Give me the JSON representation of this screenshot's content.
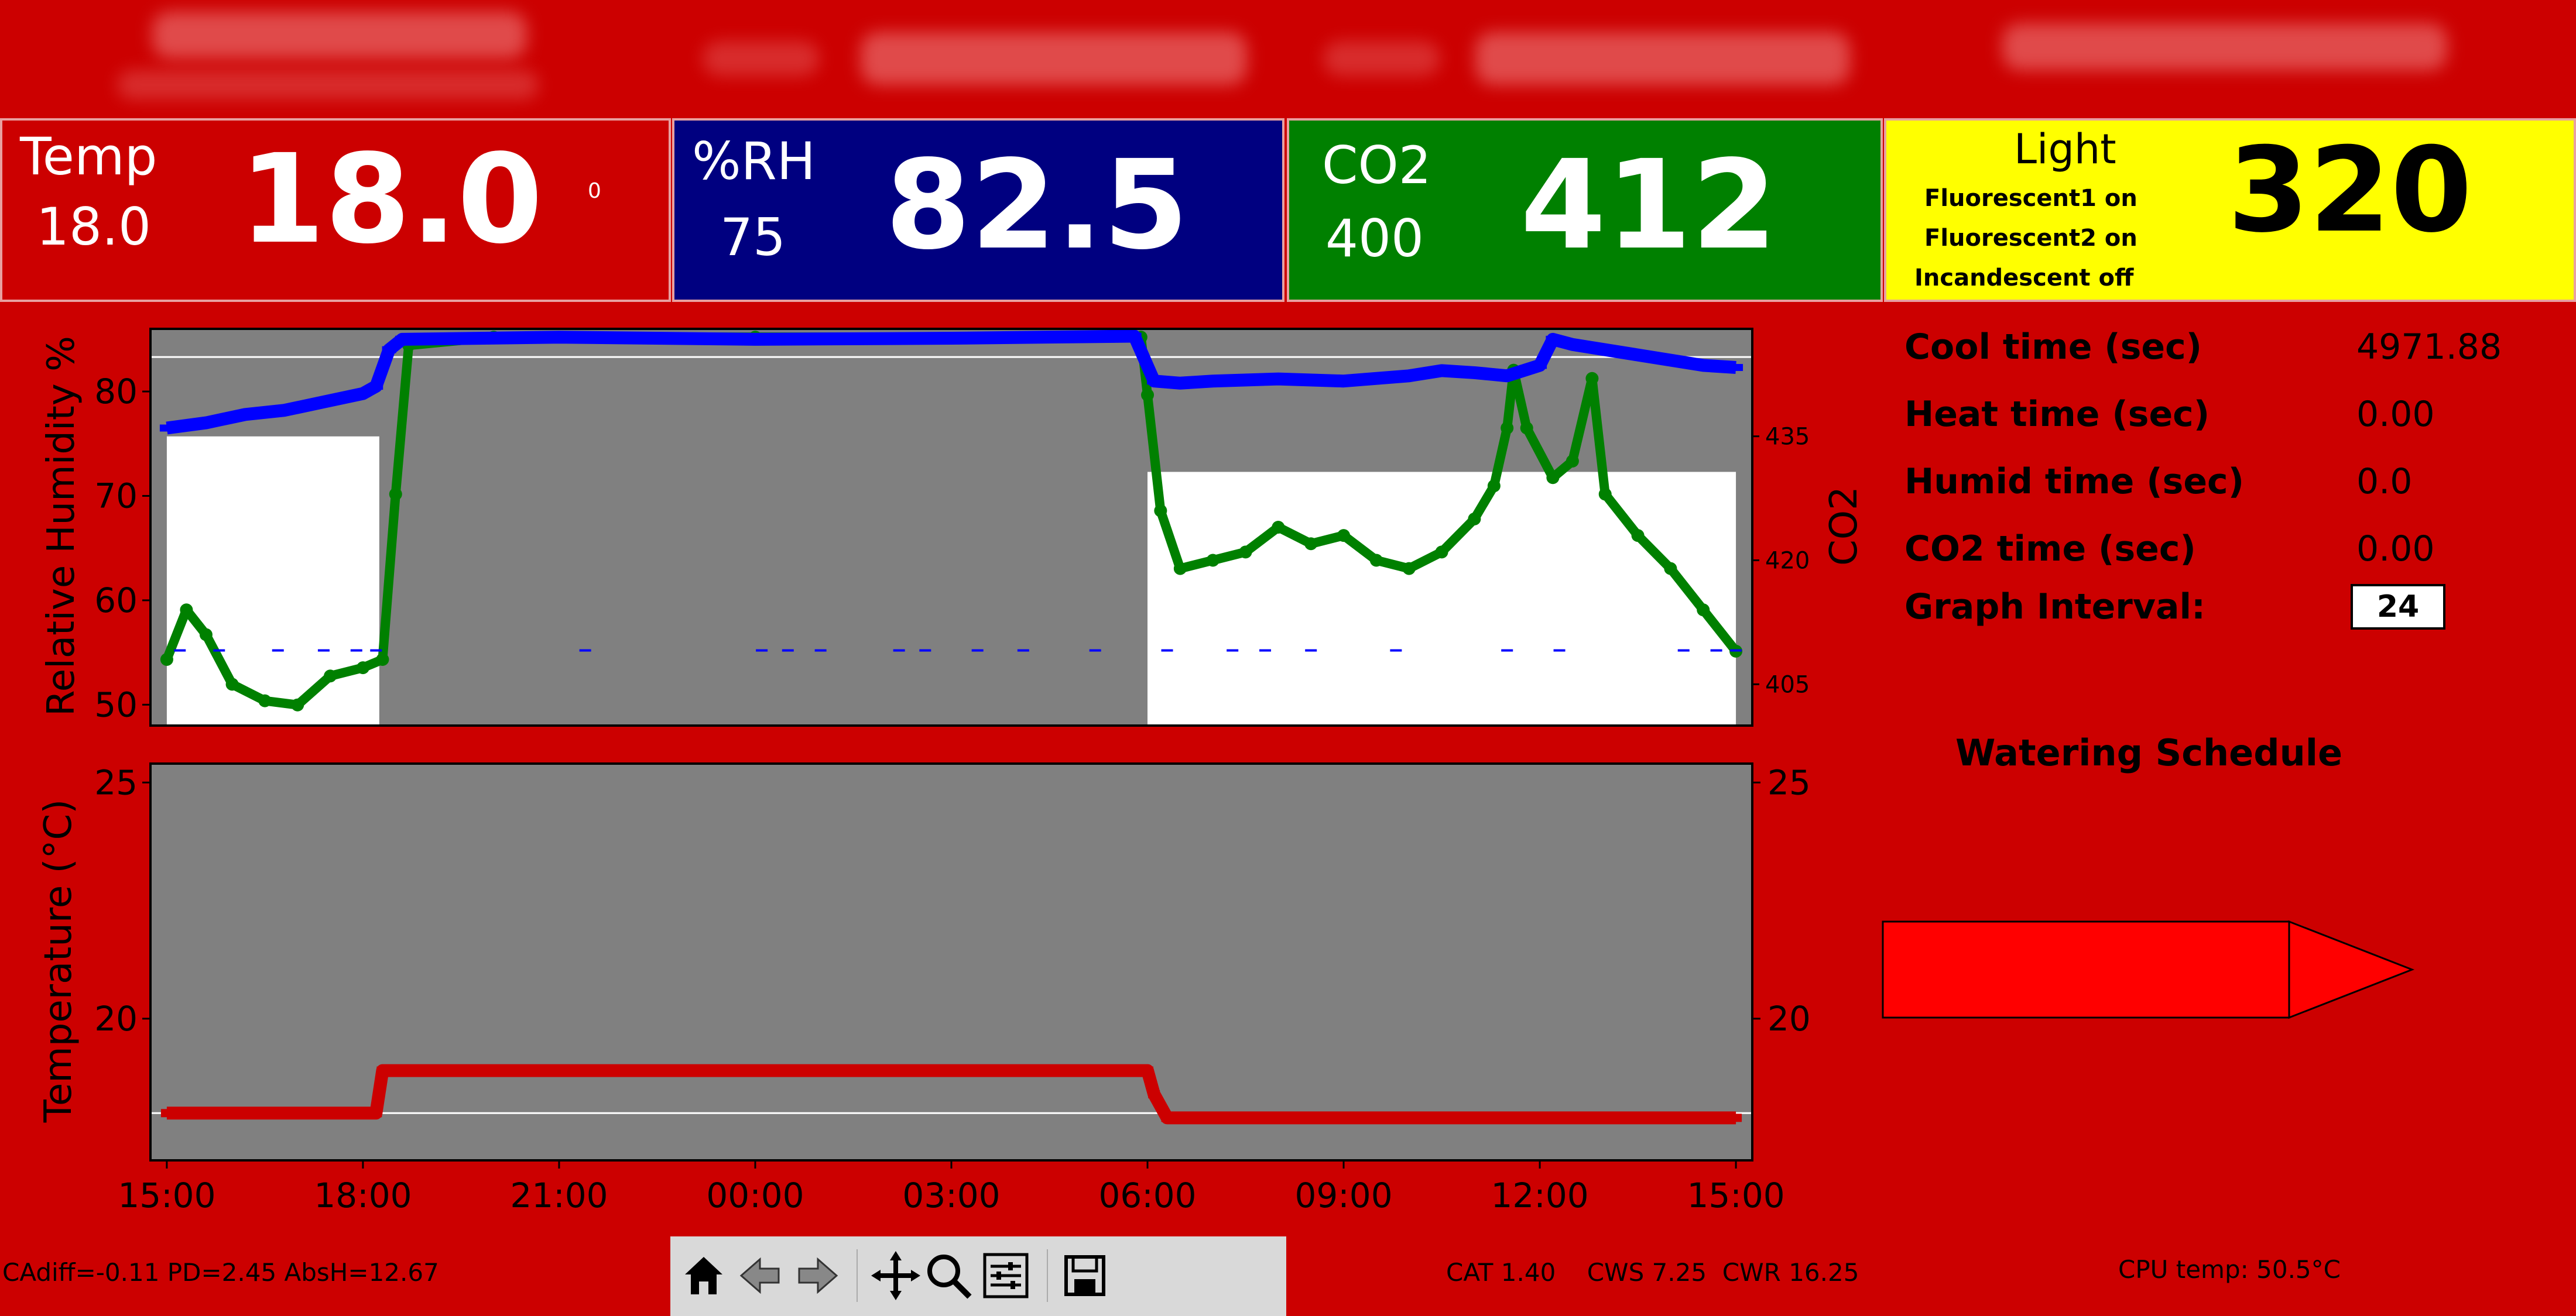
{
  "colors": {
    "background": "#cc0000",
    "rh_panel": "#000080",
    "co2_panel": "#008000",
    "light_panel": "#ffff00",
    "plot_bg": "#808080",
    "rh_series": "#0000ff",
    "co2_series": "#008000",
    "temp_series": "#cc0000",
    "light_on_band": "#ffffff"
  },
  "panels": {
    "temp": {
      "label": "Temp",
      "setpoint": "18.0",
      "value": "18.0",
      "unit_marker": "0"
    },
    "rh": {
      "label": "%RH",
      "setpoint": "75",
      "value": "82.5"
    },
    "co2": {
      "label": "CO2",
      "setpoint": "400",
      "value": "412"
    },
    "light": {
      "label": "Light",
      "lines": [
        "Fluorescent1 on",
        "Fluorescent2 on",
        "Incandescent off"
      ],
      "value": "320"
    }
  },
  "stats": [
    {
      "label": "Cool time (sec)",
      "value": "4971.88"
    },
    {
      "label": "Heat time (sec)",
      "value": "0.00"
    },
    {
      "label": "Humid time (sec)",
      "value": "0.0"
    },
    {
      "label": "CO2 time (sec)",
      "value": "0.00"
    }
  ],
  "graph_interval": {
    "label": "Graph Interval:",
    "value": "24"
  },
  "watering": {
    "title": "Watering Schedule"
  },
  "footer": {
    "left": "CAdiff=-0.11 PD=2.45 AbsH=12.67",
    "mid": "CAT 1.40    CWS 7.25  CWR 16.25",
    "right": "CPU temp: 50.5°C"
  },
  "toolbar": {
    "icons": [
      "home-icon",
      "back-arrow-icon",
      "forward-arrow-icon",
      "pan-icon",
      "zoom-icon",
      "configure-subplots-icon",
      "save-icon"
    ]
  },
  "chart_data": [
    {
      "type": "scatter",
      "ylabel": "Relative Humidity %",
      "y2label": "CO2",
      "ylim": [
        48,
        86
      ],
      "y2lim": [
        400,
        448
      ],
      "yticks": [
        "50",
        "60",
        "70",
        "80"
      ],
      "y2ticks": [
        "405",
        "420",
        "435"
      ],
      "x_range_hours": [
        -0.25,
        24.25
      ],
      "series": [
        {
          "axis": "left",
          "points": [
            [
              0,
              76.5
            ],
            [
              0.6,
              77
            ],
            [
              1.2,
              77.8
            ],
            [
              1.8,
              78.2
            ],
            [
              2.4,
              79
            ],
            [
              3,
              79.8
            ],
            [
              3.2,
              80.5
            ],
            [
              3.4,
              84
            ],
            [
              3.6,
              85
            ],
            [
              6,
              85.2
            ],
            [
              9,
              85
            ],
            [
              12,
              85.1
            ],
            [
              14.8,
              85.3
            ],
            [
              15.1,
              81
            ],
            [
              15.5,
              80.8
            ],
            [
              16,
              81
            ],
            [
              17,
              81.2
            ],
            [
              18,
              81
            ],
            [
              19,
              81.5
            ],
            [
              19.5,
              82
            ],
            [
              20,
              81.8
            ],
            [
              20.5,
              81.5
            ],
            [
              21,
              82.5
            ],
            [
              21.2,
              85
            ],
            [
              21.5,
              84.5
            ],
            [
              22.5,
              83.5
            ],
            [
              23.5,
              82.5
            ],
            [
              24,
              82.3
            ]
          ]
        },
        {
          "axis": "right",
          "points": [
            [
              0,
              408
            ],
            [
              0.3,
              414
            ],
            [
              0.6,
              411
            ],
            [
              1,
              405
            ],
            [
              1.5,
              403
            ],
            [
              2,
              402.5
            ],
            [
              2.5,
              406
            ],
            [
              3,
              407
            ],
            [
              3.3,
              408
            ],
            [
              3.5,
              428
            ],
            [
              3.7,
              446
            ],
            [
              5,
              447
            ],
            [
              9,
              447
            ],
            [
              14.9,
              447
            ],
            [
              15,
              440
            ],
            [
              15.2,
              426
            ],
            [
              15.5,
              419
            ],
            [
              16,
              420
            ],
            [
              16.5,
              421
            ],
            [
              17,
              424
            ],
            [
              17.5,
              422
            ],
            [
              18,
              423
            ],
            [
              18.5,
              420
            ],
            [
              19,
              419
            ],
            [
              19.5,
              421
            ],
            [
              20,
              425
            ],
            [
              20.3,
              429
            ],
            [
              20.5,
              436
            ],
            [
              20.6,
              443
            ],
            [
              20.8,
              436
            ],
            [
              21.2,
              430
            ],
            [
              21.5,
              432
            ],
            [
              21.8,
              442
            ],
            [
              22,
              428
            ],
            [
              22.5,
              423
            ],
            [
              23,
              419
            ],
            [
              23.5,
              414
            ],
            [
              24,
              409
            ]
          ]
        },
        {
          "axis": "left",
          "name": "",
          "markers": [
            0.2,
            0.8,
            1.7,
            2.4,
            2.9,
            3.2,
            6.4,
            9.1,
            9.5,
            10,
            11.2,
            11.6,
            12.4,
            13.1,
            14.2,
            15.3,
            16.3,
            16.8,
            17.5,
            18.8,
            20.5,
            21.3,
            23.2,
            23.7,
            24
          ],
          "level": 55.2
        }
      ],
      "light_on_intervals_hours": [
        [
          0,
          3.25
        ],
        [
          15,
          24
        ]
      ]
    },
    {
      "type": "line",
      "ylabel": "Temperature (°C)",
      "ylim": [
        17,
        25.4
      ],
      "yticks": [
        "20",
        "25"
      ],
      "xticks": [
        "15:00",
        "18:00",
        "21:00",
        "00:00",
        "03:00",
        "06:00",
        "09:00",
        "12:00",
        "15:00"
      ],
      "series": [
        {
          "points": [
            [
              0,
              18.0
            ],
            [
              3.2,
              18.0
            ],
            [
              3.3,
              18.9
            ],
            [
              15,
              18.9
            ],
            [
              15.1,
              18.4
            ],
            [
              15.3,
              17.9
            ],
            [
              24,
              17.9
            ]
          ]
        }
      ]
    }
  ]
}
